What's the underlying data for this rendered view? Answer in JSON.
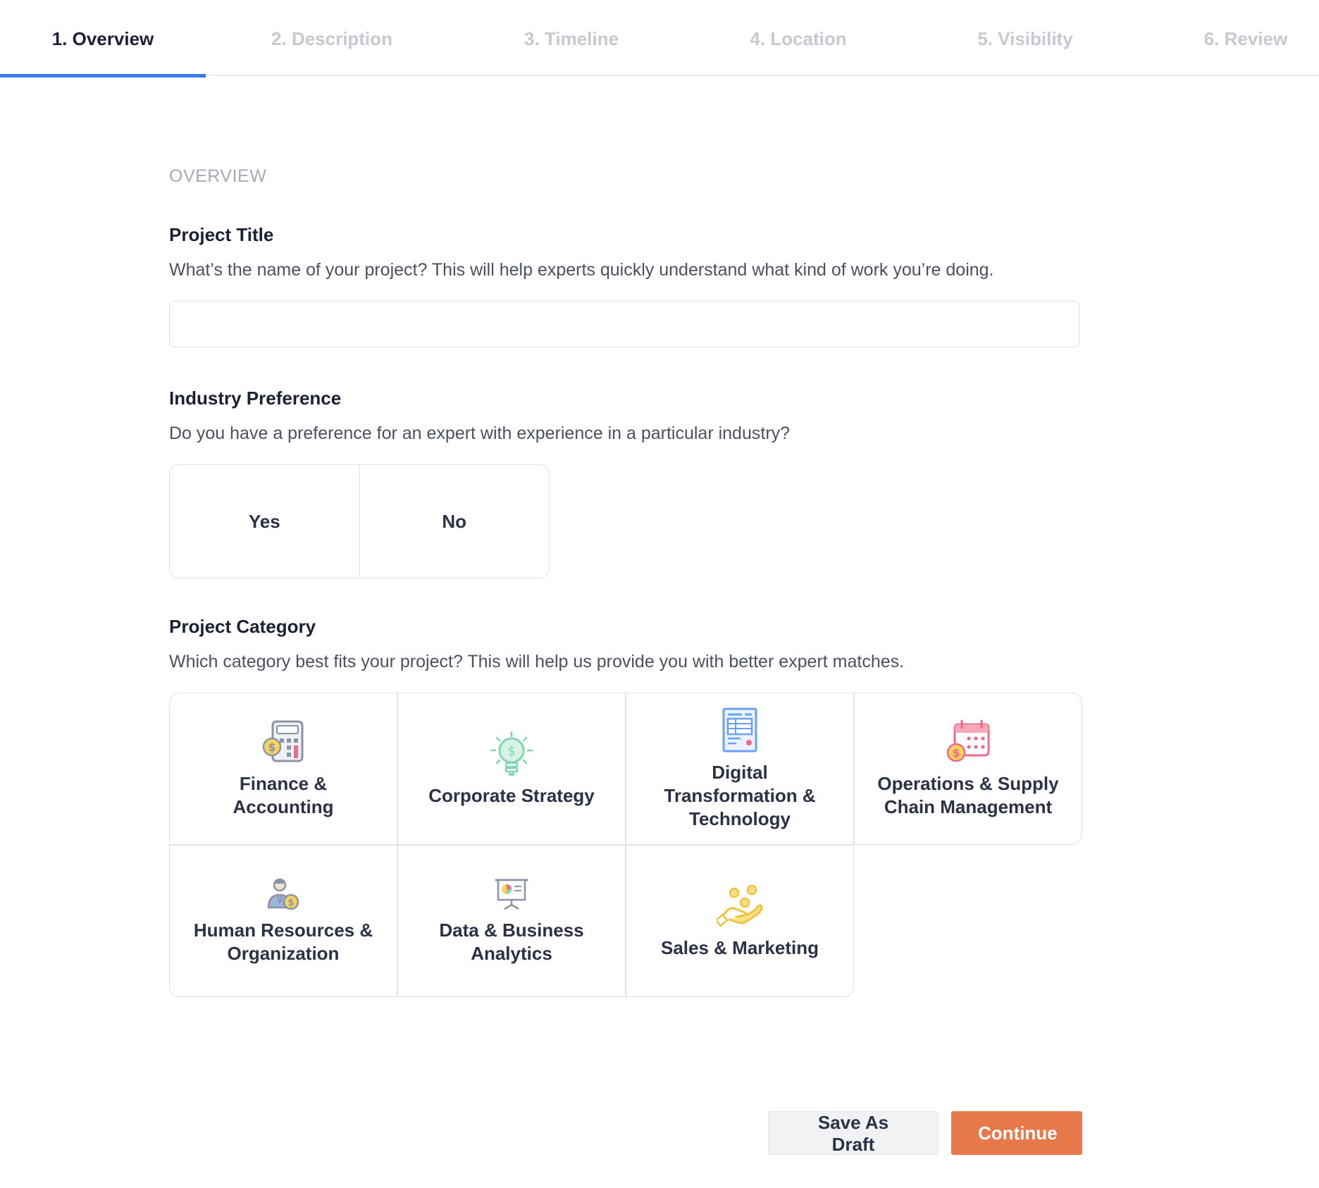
{
  "steps": [
    {
      "label": "1. Overview",
      "active": true
    },
    {
      "label": "2. Description",
      "active": false
    },
    {
      "label": "3. Timeline",
      "active": false
    },
    {
      "label": "4. Location",
      "active": false
    },
    {
      "label": "5. Visibility",
      "active": false
    },
    {
      "label": "6. Review",
      "active": false
    }
  ],
  "form": {
    "section_title": "OVERVIEW",
    "project_title": {
      "label": "Project Title",
      "help": "What’s the name of your project? This will help experts quickly understand what kind of work you’re doing.",
      "value": "",
      "placeholder": ""
    },
    "industry": {
      "label": "Industry Preference",
      "help": "Do you have a preference for an expert with experience in a particular industry?",
      "options": [
        "Yes",
        "No"
      ]
    },
    "category": {
      "label": "Project Category",
      "help": "Which category best fits your project? This will help us provide you with better expert matches.",
      "items": [
        {
          "label": "Finance & Accounting",
          "icon": "calculator-icon"
        },
        {
          "label": "Corporate Strategy",
          "icon": "lightbulb-icon"
        },
        {
          "label": "Digital Transformation & Technology",
          "icon": "document-icon"
        },
        {
          "label": "Operations & Supply Chain Management",
          "icon": "calendar-icon"
        },
        {
          "label": "Human Resources & Organization",
          "icon": "person-money-icon"
        },
        {
          "label": "Data & Business Analytics",
          "icon": "presentation-board-icon"
        },
        {
          "label": "Sales & Marketing",
          "icon": "hand-coins-icon"
        }
      ]
    }
  },
  "actions": {
    "save_draft": "Save As Draft",
    "continue": "Continue"
  },
  "colors": {
    "accent_blue": "#3c79ee",
    "primary_orange": "#e8794a",
    "text_dark": "#1b2134",
    "muted": "#c4c9d2"
  }
}
